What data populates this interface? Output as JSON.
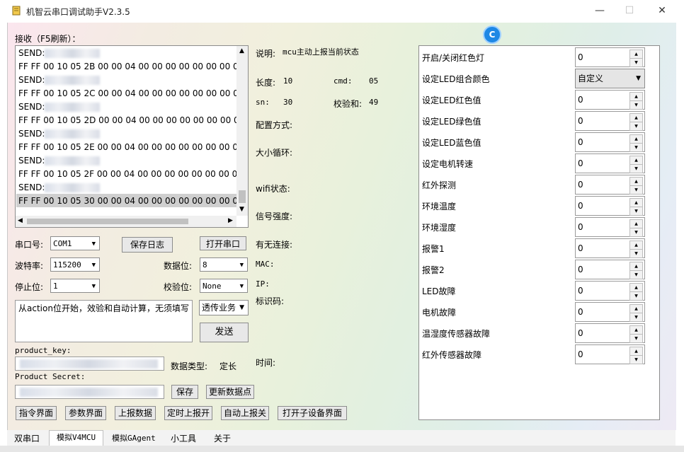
{
  "window": {
    "title": "机智云串口调试助手V2.3.5",
    "minimize_glyph": "—",
    "maximize_glyph": "☐",
    "close_glyph": "✕"
  },
  "receive": {
    "label": "接收（F5刷新）：",
    "lines": [
      "SEND:",
      "FF FF 00 10 05 2B 00 00 04 00 00 00 00 00 00 00 0",
      "SEND:",
      "FF FF 00 10 05 2C 00 00 04 00 00 00 00 00 00 00 0",
      "SEND:",
      "FF FF 00 10 05 2D 00 00 04 00 00 00 00 00 00 00 0",
      "SEND:",
      "FF FF 00 10 05 2E 00 00 04 00 00 00 00 00 00 00 0",
      "SEND:",
      "FF FF 00 10 05 2F 00 00 04 00 00 00 00 00 00 00 0",
      "SEND:",
      "FF FF 00 10 05 30 00 00 04 00 00 00 00 00 00 00 0"
    ],
    "selected_index": 11
  },
  "serial": {
    "port_label": "串口号:",
    "port_value": "COM1",
    "save_log": "保存日志",
    "open_port": "打开串口",
    "baud_label": "波特率:",
    "baud_value": "115200",
    "databits_label": "数据位:",
    "databits_value": "8",
    "stopbits_label": "停止位:",
    "stopbits_value": "1",
    "parity_label": "校验位:",
    "parity_value": "None"
  },
  "send": {
    "text": "从action位开始，效验和自动计算，无须填写",
    "mode_value": "透传业务",
    "send_button": "发送"
  },
  "product": {
    "key_label": "product_key:",
    "secret_label": "Product Secret:",
    "data_type_label": "数据类型:",
    "data_type_value": "定长",
    "save_button": "保存",
    "update_button": "更新数据点"
  },
  "bottom_buttons": [
    "指令界面",
    "参数界面",
    "上报数据",
    "定时上报开",
    "自动上报关",
    "打开子设备界面"
  ],
  "info": {
    "desc_label": "说明:",
    "desc_value": "mcu主动上报当前状态",
    "length_label": "长度:",
    "length_value": "10",
    "cmd_label": "cmd:",
    "cmd_value": "05",
    "sn_label": "sn:",
    "sn_value": "30",
    "checksum_label": "校验和:",
    "checksum_value": "49",
    "config_label": "配置方式:",
    "cycle_label": "大小循环:",
    "wifi_label": "wifi状态:",
    "signal_label": "信号强度:",
    "conn_label": "有无连接:",
    "mac_label": "MAC:",
    "ip_label": "IP:",
    "id_label": "标识码:",
    "time_label": "时间:"
  },
  "datapoints": [
    {
      "label": "开启/关闭红色灯",
      "value": "0",
      "kind": "spin"
    },
    {
      "label": "设定LED组合颜色",
      "value": "自定义",
      "kind": "combo"
    },
    {
      "label": "设定LED红色值",
      "value": "0",
      "kind": "spin"
    },
    {
      "label": "设定LED绿色值",
      "value": "0",
      "kind": "spin"
    },
    {
      "label": "设定LED蓝色值",
      "value": "0",
      "kind": "spin"
    },
    {
      "label": "设定电机转速",
      "value": "0",
      "kind": "spin"
    },
    {
      "label": "红外探测",
      "value": "0",
      "kind": "spin"
    },
    {
      "label": "环境温度",
      "value": "0",
      "kind": "spin"
    },
    {
      "label": "环境湿度",
      "value": "0",
      "kind": "spin"
    },
    {
      "label": "报警1",
      "value": "0",
      "kind": "spin"
    },
    {
      "label": "报警2",
      "value": "0",
      "kind": "spin"
    },
    {
      "label": "LED故障",
      "value": "0",
      "kind": "spin"
    },
    {
      "label": "电机故障",
      "value": "0",
      "kind": "spin"
    },
    {
      "label": "温湿度传感器故障",
      "value": "0",
      "kind": "spin"
    },
    {
      "label": "红外传感器故障",
      "value": "0",
      "kind": "spin"
    }
  ],
  "tabs": [
    "双串口",
    "模拟V4MCU",
    "模拟GAgent",
    "小工具",
    "关于"
  ],
  "active_tab": 1,
  "floating_badge": "C",
  "colors": {
    "badge": "#1e88e5",
    "selected_row": "#cfcfcf"
  }
}
